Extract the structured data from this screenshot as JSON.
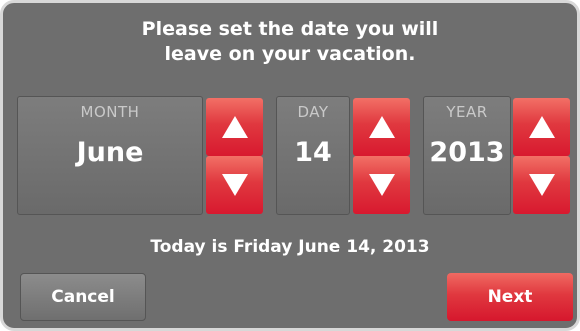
{
  "prompt": "Please set the date you will\nleave on your vacation.",
  "fields": {
    "month": {
      "label": "MONTH",
      "value": "June"
    },
    "day": {
      "label": "DAY",
      "value": "14"
    },
    "year": {
      "label": "YEAR",
      "value": "2013"
    }
  },
  "today_text": "Today is Friday June 14, 2013",
  "buttons": {
    "cancel": "Cancel",
    "next": "Next"
  },
  "colors": {
    "background": "#6e6e6e",
    "accent_red": "#e0383f",
    "text": "#ffffff",
    "label": "#c9c9c9"
  },
  "icons": {
    "increment": "arrow-up-icon",
    "decrement": "arrow-down-icon"
  }
}
